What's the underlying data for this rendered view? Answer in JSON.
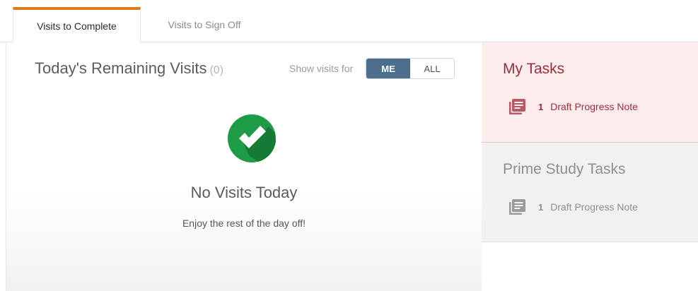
{
  "tabs": {
    "active_label": "Visits to Complete",
    "inactive_label": "Visits to Sign Off"
  },
  "visits": {
    "title": "Today's Remaining Visits",
    "count": "(0)",
    "show_for_label": "Show visits for",
    "toggle_me": "ME",
    "toggle_all": "ALL",
    "selected": "ME",
    "empty_title": "No Visits Today",
    "empty_message": "Enjoy the rest of the day off!"
  },
  "my_tasks": {
    "title": "My Tasks",
    "items": [
      {
        "count": "1",
        "label": "Draft Progress Note"
      }
    ]
  },
  "prime_tasks": {
    "title": "Prime Study Tasks",
    "items": [
      {
        "count": "1",
        "label": "Draft Progress Note"
      }
    ]
  },
  "colors": {
    "tab_accent": "#e07a1f",
    "toggle_active": "#4e6e8e",
    "success_green": "#1e9b46",
    "my_tasks_text": "#9b2f3d",
    "my_tasks_bg": "#fcecec",
    "prime_bg": "#f1f1f1"
  },
  "icons": {
    "check": "check-circle-icon",
    "task": "document-stack-icon"
  }
}
